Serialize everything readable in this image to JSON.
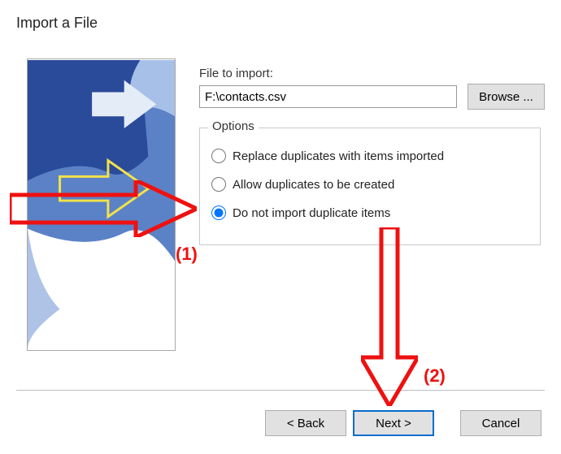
{
  "dialog": {
    "title": "Import a File",
    "file_label": "File to import:",
    "file_value": "F:\\contacts.csv",
    "browse_label": "Browse ..."
  },
  "options": {
    "legend": "Options",
    "items": [
      {
        "label": "Replace duplicates with items imported",
        "selected": false
      },
      {
        "label": "Allow duplicates to be created",
        "selected": false
      },
      {
        "label": "Do not import duplicate items",
        "selected": true
      }
    ]
  },
  "buttons": {
    "back": "< Back",
    "next": "Next >",
    "cancel": "Cancel"
  },
  "annotations": {
    "one": "(1)",
    "two": "(2)"
  }
}
